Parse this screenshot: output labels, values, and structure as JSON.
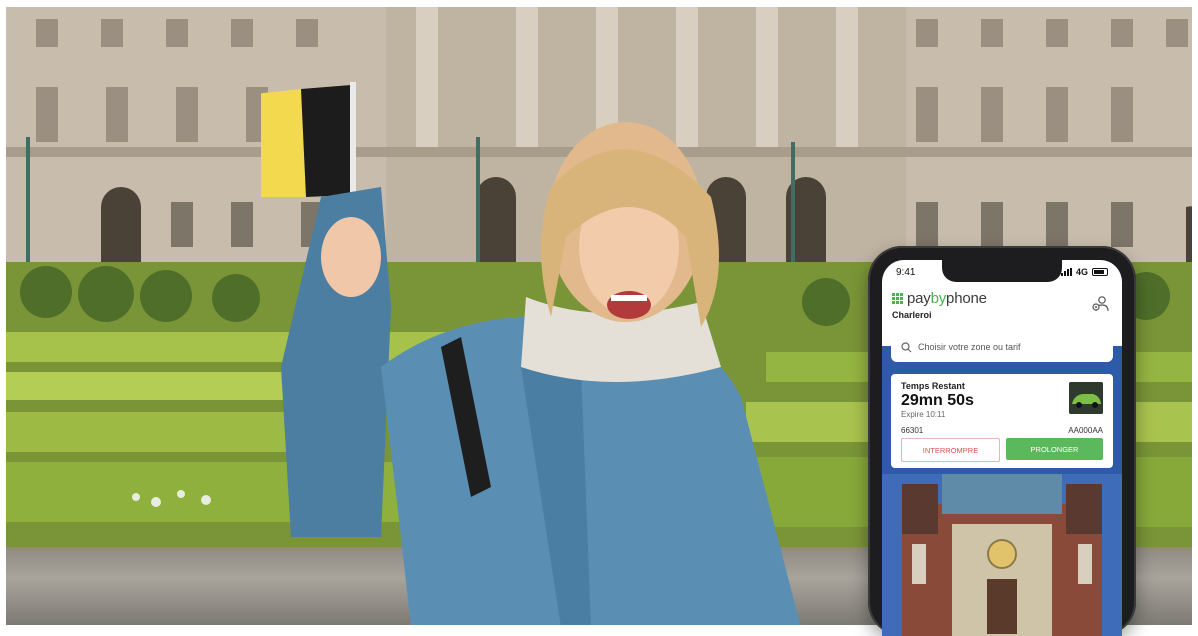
{
  "phone": {
    "status_time": "9:41",
    "network": "4G",
    "brand_prefix": "pay",
    "brand_mid": "by",
    "brand_suffix": "phone",
    "city": "Charleroi",
    "search_placeholder": "Choisir votre zone ou tarif",
    "session": {
      "label": "Temps Restant",
      "remaining": "29mn 50s",
      "expires": "Expire 10:11",
      "zone": "66301",
      "plate": "AA000AA",
      "stop_label": "INTERROMPRE",
      "extend_label": "PROLONGER"
    }
  },
  "colors": {
    "brand_green": "#4caf50",
    "app_blue": "#2e5ba8",
    "stop_red": "#d9534f",
    "extend_green": "#5cb85c",
    "flag_black": "#1c1c1c",
    "flag_yellow": "#f2d94e",
    "flag_red": "#e8382e"
  }
}
